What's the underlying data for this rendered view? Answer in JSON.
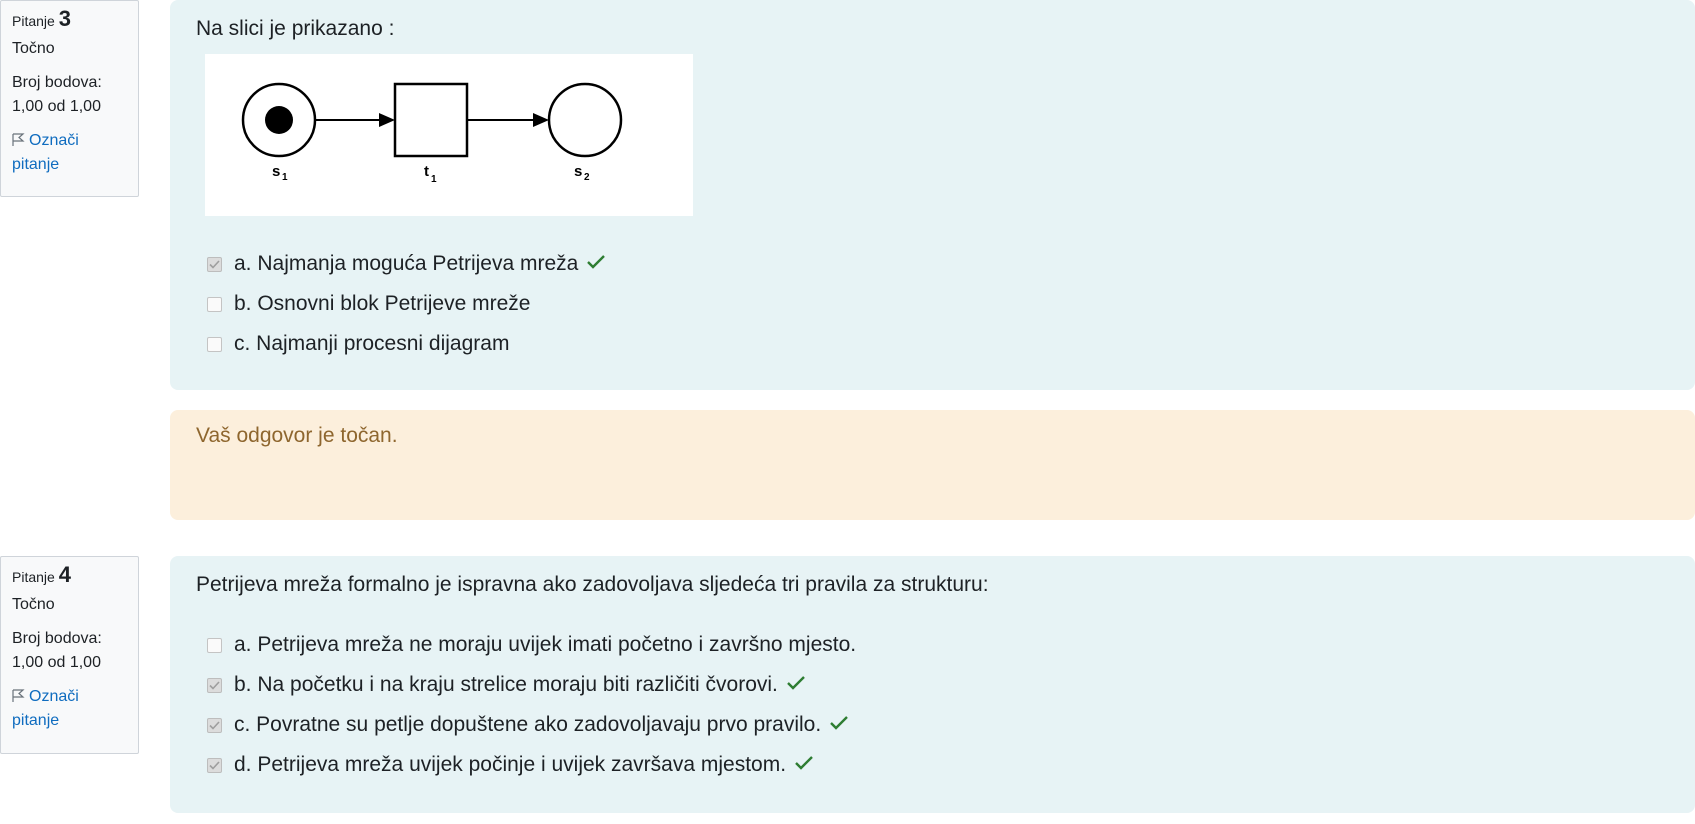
{
  "questions": [
    {
      "label": "Pitanje",
      "number": "3",
      "state": "Točno",
      "grade_label": "Broj bodova:",
      "grade_value": "1,00 od 1,00",
      "flag_label": "Označi pitanje",
      "text": "Na slici je prikazano :",
      "diagram_labels": {
        "s1": "s",
        "s1_sub": "1",
        "t1": "t",
        "t1_sub": "1",
        "s2": "s",
        "s2_sub": "2"
      },
      "answers": [
        {
          "text": "a. Najmanja moguća Petrijeva mreža",
          "checked": true,
          "correct": true
        },
        {
          "text": "b. Osnovni blok Petrijeve mreže",
          "checked": false,
          "correct": false
        },
        {
          "text": "c. Najmanji procesni dijagram",
          "checked": false,
          "correct": false
        }
      ],
      "feedback": "Vaš odgovor je točan."
    },
    {
      "label": "Pitanje",
      "number": "4",
      "state": "Točno",
      "grade_label": "Broj bodova:",
      "grade_value": "1,00 od 1,00",
      "flag_label": "Označi pitanje",
      "text": "Petrijeva mreža formalno je ispravna ako zadovoljava sljedeća tri pravila za strukturu:",
      "answers": [
        {
          "text": "a. Petrijeva mreža ne moraju uvijek imati početno i završno mjesto.",
          "checked": false,
          "correct": false
        },
        {
          "text": "b. Na početku i na kraju strelice moraju biti različiti čvorovi.",
          "checked": true,
          "correct": true
        },
        {
          "text": "c. Povratne su petlje dopuštene ako zadovoljavaju prvo pravilo.",
          "checked": true,
          "correct": true
        },
        {
          "text": "d. Petrijeva mreža uvijek počinje i uvijek završava mjestom.",
          "checked": true,
          "correct": true
        }
      ]
    }
  ],
  "colors": {
    "correct": "#2e7d32",
    "link": "#0f6cbf",
    "formulation_bg": "#e7f3f5",
    "feedback_bg": "#fcefdc",
    "feedback_text": "#8e662e"
  }
}
